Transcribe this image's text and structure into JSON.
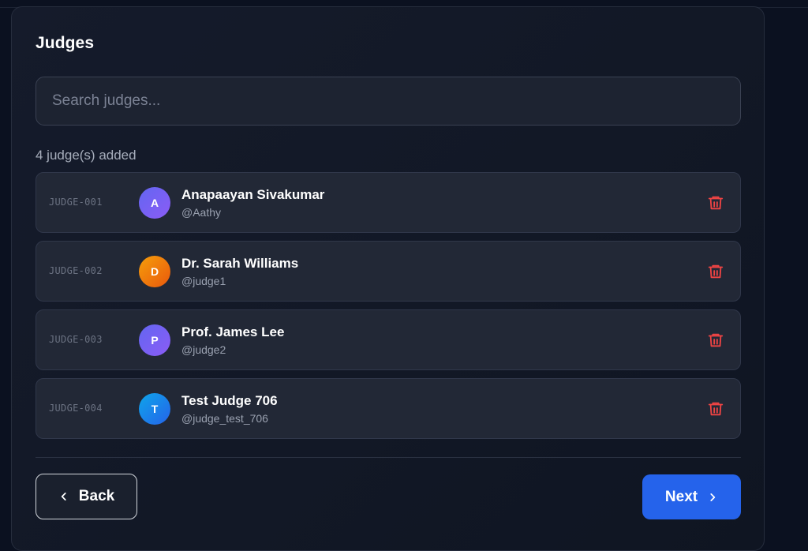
{
  "panel": {
    "title": "Judges",
    "search": {
      "placeholder": "Search judges...",
      "value": ""
    },
    "count_text": "4 judge(s) added"
  },
  "judges": [
    {
      "id": "JUDGE-001",
      "initial": "A",
      "name": "Anapaayan Sivakumar",
      "handle": "@Aathy",
      "avatar_gradient": [
        "#6366f1",
        "#8b5cf6"
      ]
    },
    {
      "id": "JUDGE-002",
      "initial": "D",
      "name": "Dr. Sarah Williams",
      "handle": "@judge1",
      "avatar_gradient": [
        "#f59e0b",
        "#ea580c"
      ]
    },
    {
      "id": "JUDGE-003",
      "initial": "P",
      "name": "Prof. James Lee",
      "handle": "@judge2",
      "avatar_gradient": [
        "#6366f1",
        "#8b5cf6"
      ]
    },
    {
      "id": "JUDGE-004",
      "initial": "T",
      "name": "Test Judge 706",
      "handle": "@judge_test_706",
      "avatar_gradient": [
        "#0ea5e9",
        "#2563eb"
      ]
    }
  ],
  "actions": {
    "back_label": "Back",
    "next_label": "Next"
  },
  "icons": {
    "delete": "trash-icon",
    "back": "chevron-left-icon",
    "next": "chevron-right-icon"
  },
  "colors": {
    "accent": "#2563eb",
    "danger": "#ef4444",
    "background": "#0b1120",
    "card": "#151b2b"
  }
}
